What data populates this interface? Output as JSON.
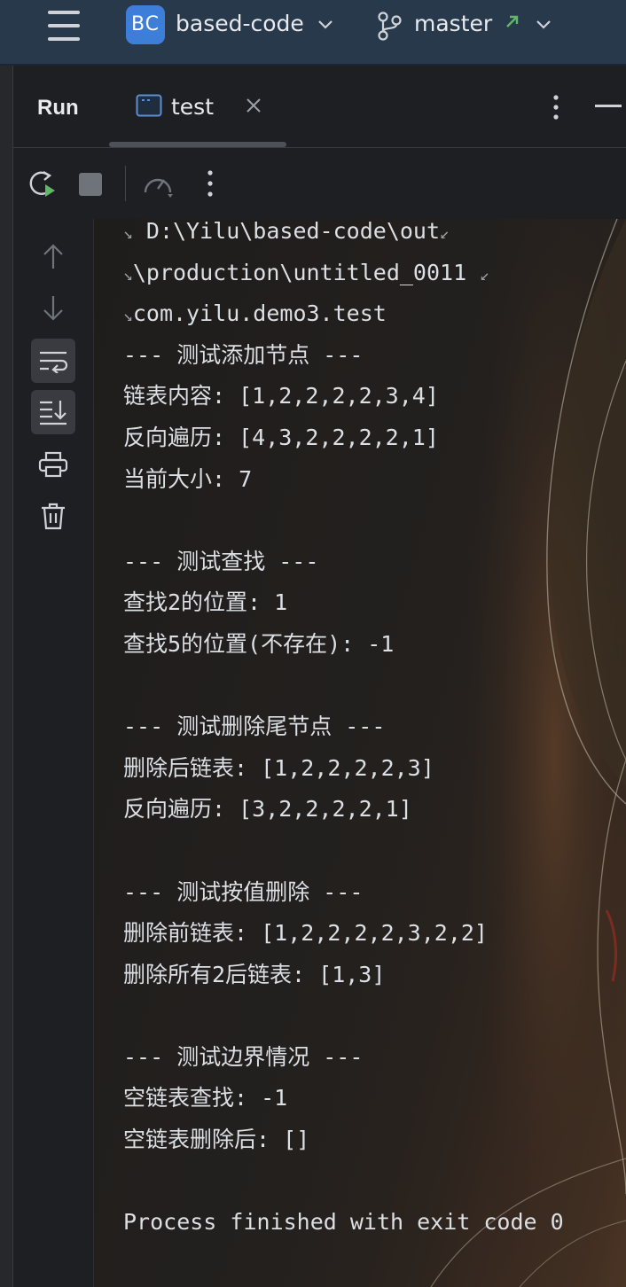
{
  "titlebar": {
    "project_badge": "BC",
    "project_name": "based-code",
    "branch_name": "master",
    "icons": [
      "hamburger-icon",
      "chevron-down-icon",
      "branch-icon",
      "arrow-up-right-icon"
    ],
    "colors": {
      "titlebar_bg": "#27394b",
      "badge_bg": "#3d7ed8",
      "branch_arrow": "#5fb865"
    }
  },
  "run_panel": {
    "label": "Run",
    "tabs": [
      {
        "label": "test",
        "icon": "console-icon",
        "closable": true
      }
    ]
  },
  "toolbar": {
    "icons": [
      "rerun-icon",
      "stop-icon",
      "profiler-icon",
      "more-vertical-icon"
    ]
  },
  "side_actions": {
    "icons": [
      "scroll-up-icon",
      "scroll-down-icon",
      "soft-wrap-icon",
      "scroll-to-end-icon",
      "print-icon",
      "trash-icon"
    ],
    "active": [
      "soft-wrap-icon",
      "scroll-to-end-icon"
    ]
  },
  "console": {
    "lines": [
      " D:\\Yilu\\based-code\\out",
      "\\production\\untitled_0011 ",
      "com.yilu.demo3.test",
      "--- 测试添加节点 ---",
      "链表内容: [1,2,2,2,2,3,4]",
      "反向遍历: [4,3,2,2,2,2,1]",
      "当前大小: 7",
      "",
      "--- 测试查找 ---",
      "查找2的位置: 1",
      "查找5的位置(不存在): -1",
      "",
      "--- 测试删除尾节点 ---",
      "删除后链表: [1,2,2,2,2,3]",
      "反向遍历: [3,2,2,2,2,1]",
      "",
      "--- 测试按值删除 ---",
      "删除前链表: [1,2,2,2,2,3,2,2]",
      "删除所有2后链表: [1,3]",
      "",
      "--- 测试边界情况 ---",
      "空链表查找: -1",
      "空链表删除后: []",
      "",
      "Process finished with exit code 0"
    ]
  }
}
